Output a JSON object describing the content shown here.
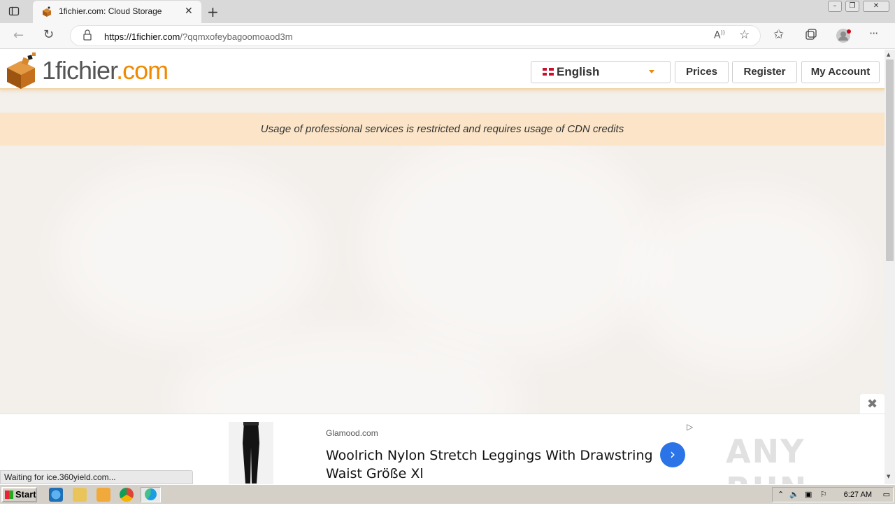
{
  "browser": {
    "tab_title": "1fichier.com: Cloud Storage",
    "url_domain": "https://1fichier.com",
    "url_path": "/?qqmxofeybagoomoaod3m"
  },
  "site": {
    "logo_part1": "1fichier",
    "logo_part2": ".com",
    "language": "English",
    "nav": {
      "prices": "Prices",
      "register": "Register",
      "account": "My Account"
    },
    "notice": "Usage of professional services is restricted and requires usage of CDN credits"
  },
  "ad": {
    "source": "Glamood.com",
    "title": "Woolrich Nylon Stretch Leggings With Drawstring Waist Größe Xl",
    "watermark": "ANY RUN"
  },
  "status_text": "Waiting for ice.360yield.com...",
  "taskbar": {
    "start_label": "Start",
    "clock": "6:27 AM"
  },
  "colors": {
    "brand_orange": "#f08a00",
    "notice_bg": "#fbe4c7",
    "ad_button": "#2a74e8"
  }
}
